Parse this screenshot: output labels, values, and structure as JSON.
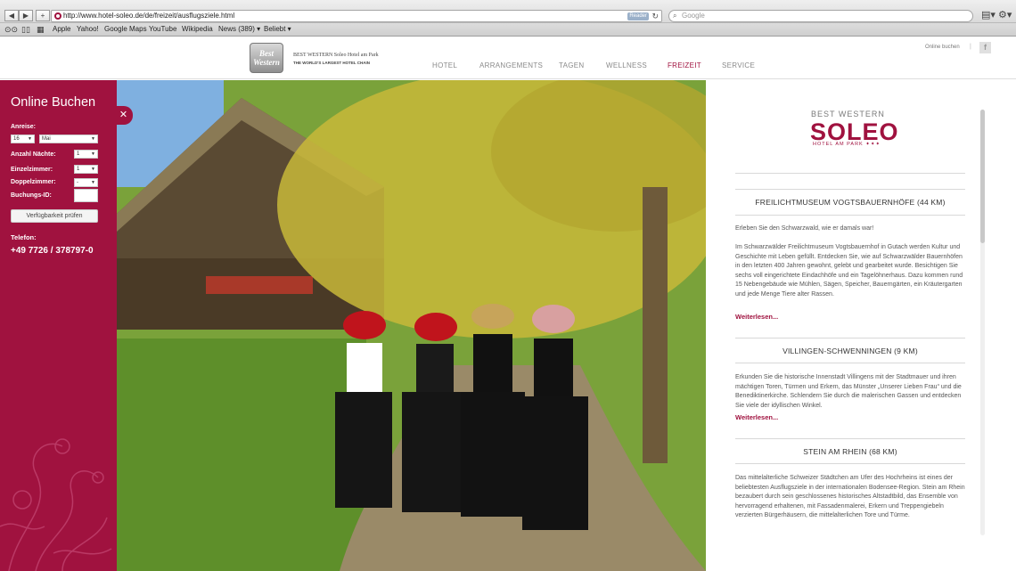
{
  "browser": {
    "url": "http://www.hotel-soleo.de/de/freizeit/ausflugsziele.html",
    "reader_label": "Reader",
    "search_placeholder": "Google",
    "nav_back": "◀",
    "nav_forward": "▶",
    "add": "+",
    "bookmarks": [
      "Apple",
      "Yahoo!",
      "Google Maps",
      "YouTube",
      "Wikipedia",
      "News (389) ▾",
      "Beliebt ▾"
    ]
  },
  "header": {
    "logo_text": "Best Western",
    "brand_line1": "BEST WESTERN Soleo Hotel am Park",
    "brand_line2": "THE WORLD'S LARGEST HOTEL CHAIN",
    "nav": [
      "HOTEL",
      "ARRANGEMENTS",
      "TAGEN",
      "WELLNESS",
      "FREIZEIT",
      "SERVICE"
    ],
    "active_nav": "FREIZEIT",
    "online_link": "Online buchen",
    "facebook": "f"
  },
  "booking": {
    "title": "Online Buchen",
    "arrival_label": "Anreise:",
    "day_value": "16",
    "month_value": "Mai",
    "nights_label": "Anzahl Nächte:",
    "nights_value": "1",
    "single_label": "Einzelzimmer:",
    "single_value": "1",
    "double_label": "Doppelzimmer:",
    "double_value": "-",
    "booking_id_label": "Buchungs-ID:",
    "check_button": "Verfügbarkeit prüfen",
    "phone_label": "Telefon:",
    "phone": "+49 7726 / 378797-0"
  },
  "content": {
    "logo_top": "BEST WESTERN",
    "logo_main": "SOLEO",
    "logo_sub": "HOTEL AM PARK ✦✦✦",
    "sections": [
      {
        "title": "FREILICHTMUSEUM VOGTSBAUERNHÖFE (44 KM)",
        "intro": "Erleben Sie den Schwarzwald, wie er damals war!",
        "text": "Im Schwarzwälder Freilichtmuseum Vogtsbauernhof in Gutach werden Kultur und Geschichte mit Leben gefüllt. Entdecken Sie, wie auf Schwarzwälder Bauernhöfen in den letzten 400 Jahren gewohnt, gelebt und gearbeitet wurde. Besichtigen Sie sechs voll eingerichtete Eindachhöfe und ein Tagelöhnerhaus. Dazu kommen rund 15 Nebengebäude wie Mühlen, Sägen, Speicher, Bauerngärten, ein Kräutergarten und jede Menge Tiere alter Rassen.",
        "more": "Weiterlesen..."
      },
      {
        "title": "VILLINGEN-SCHWENNINGEN (9 KM)",
        "text": "Erkunden Sie die historische Innenstadt Villingens mit der Stadtmauer und ihren mächtigen Toren, Türmen und Erkern, das Münster „Unserer Lieben Frau“ und die Benediktinerkirche. Schlendern Sie durch die malerischen Gassen und entdecken Sie viele der idyllischen Winkel.",
        "more": "Weiterlesen..."
      },
      {
        "title": "STEIN AM RHEIN (68 KM)",
        "text": "Das mittelalterliche Schweizer Städtchen am Ufer des Hochrheins ist eines der beliebtesten Ausflugsziele in der internationalen Bodensee-Region. Stein am Rhein bezaubert durch sein geschlossenes historisches Altstadtbild, das Ensemble von hervorragend erhaltenen, mit Fassadenmalerei, Erkern und Treppengiebeln verzierten Bürgerhäusern, die mittelalterlichen Tore und Türme."
      }
    ]
  },
  "colors": {
    "brand": "#a0123f"
  }
}
